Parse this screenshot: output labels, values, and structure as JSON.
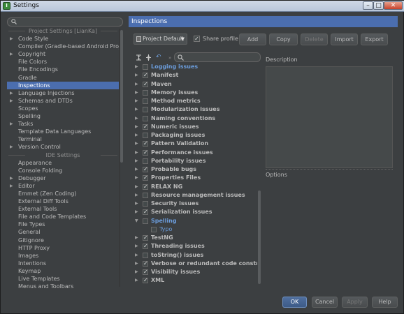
{
  "window": {
    "title": "Settings",
    "app_icon": "intellij-icon",
    "controls": [
      "minimize",
      "maximize",
      "close"
    ]
  },
  "sidebar": {
    "search_placeholder": "",
    "project_settings_header": "Project Settings [LianKa]",
    "ide_settings_header": "IDE Settings",
    "items": [
      {
        "label": "Code Style",
        "expandable": true
      },
      {
        "label": "Compiler (Gradle-based Android Proje...",
        "expandable": false
      },
      {
        "label": "Copyright",
        "expandable": true
      },
      {
        "label": "File Colors",
        "expandable": false
      },
      {
        "label": "File Encodings",
        "expandable": false
      },
      {
        "label": "Gradle",
        "expandable": false
      },
      {
        "label": "Inspections",
        "expandable": false,
        "selected": true
      },
      {
        "label": "Language Injections",
        "expandable": true
      },
      {
        "label": "Schemas and DTDs",
        "expandable": true
      },
      {
        "label": "Scopes",
        "expandable": false
      },
      {
        "label": "Spelling",
        "expandable": false
      },
      {
        "label": "Tasks",
        "expandable": true
      },
      {
        "label": "Template Data Languages",
        "expandable": false
      },
      {
        "label": "Terminal",
        "expandable": false
      },
      {
        "label": "Version Control",
        "expandable": true
      }
    ],
    "ide_items": [
      {
        "label": "Appearance",
        "expandable": false
      },
      {
        "label": "Console Folding",
        "expandable": false
      },
      {
        "label": "Debugger",
        "expandable": true
      },
      {
        "label": "Editor",
        "expandable": true
      },
      {
        "label": "Emmet (Zen Coding)",
        "expandable": false
      },
      {
        "label": "External Diff Tools",
        "expandable": false
      },
      {
        "label": "External Tools",
        "expandable": false
      },
      {
        "label": "File and Code Templates",
        "expandable": false
      },
      {
        "label": "File Types",
        "expandable": false
      },
      {
        "label": "General",
        "expandable": false
      },
      {
        "label": "Gitignore",
        "expandable": false
      },
      {
        "label": "HTTP Proxy",
        "expandable": false
      },
      {
        "label": "Images",
        "expandable": false
      },
      {
        "label": "Intentions",
        "expandable": false
      },
      {
        "label": "Keymap",
        "expandable": false
      },
      {
        "label": "Live Templates",
        "expandable": false
      },
      {
        "label": "Menus and Toolbars",
        "expandable": false
      }
    ]
  },
  "panel": {
    "header": "Inspections",
    "profile": "Project Default",
    "share_profile_label": "Share profile",
    "share_profile_checked": true,
    "buttons": {
      "add": "Add",
      "copy": "Copy",
      "delete": "Delete",
      "import": "Import",
      "export": "Export"
    },
    "toolbar_icons": [
      "expand-all-icon",
      "collapse-all-icon",
      "reset-icon",
      "search-icon"
    ],
    "inspections": [
      {
        "label": "Logging issues",
        "checked": false,
        "expanded": false,
        "highlight": true
      },
      {
        "label": "Manifest",
        "checked": true,
        "expanded": false
      },
      {
        "label": "Maven",
        "checked": true,
        "expanded": false
      },
      {
        "label": "Memory issues",
        "checked": false,
        "expanded": false
      },
      {
        "label": "Method metrics",
        "checked": false,
        "expanded": false
      },
      {
        "label": "Modularization issues",
        "checked": false,
        "expanded": false
      },
      {
        "label": "Naming conventions",
        "checked": false,
        "expanded": false
      },
      {
        "label": "Numeric issues",
        "checked": true,
        "expanded": false
      },
      {
        "label": "Packaging issues",
        "checked": false,
        "expanded": false
      },
      {
        "label": "Pattern Validation",
        "checked": true,
        "expanded": false
      },
      {
        "label": "Performance issues",
        "checked": true,
        "expanded": false
      },
      {
        "label": "Portability issues",
        "checked": false,
        "expanded": false
      },
      {
        "label": "Probable bugs",
        "checked": true,
        "expanded": false
      },
      {
        "label": "Properties Files",
        "checked": true,
        "expanded": false
      },
      {
        "label": "RELAX NG",
        "checked": true,
        "expanded": false
      },
      {
        "label": "Resource management issues",
        "checked": false,
        "expanded": false
      },
      {
        "label": "Security issues",
        "checked": false,
        "expanded": false
      },
      {
        "label": "Serialization issues",
        "checked": true,
        "expanded": false
      },
      {
        "label": "Spelling",
        "checked": false,
        "expanded": true,
        "highlight": true
      },
      {
        "label": "Typo",
        "checked": false,
        "child": true,
        "highlight": true
      },
      {
        "label": "TestNG",
        "checked": true,
        "expanded": false
      },
      {
        "label": "Threading issues",
        "checked": true,
        "expanded": false
      },
      {
        "label": "toString() issues",
        "checked": false,
        "expanded": false
      },
      {
        "label": "Verbose or redundant code constructs",
        "checked": true,
        "expanded": false
      },
      {
        "label": "Visibility issues",
        "checked": true,
        "expanded": false
      },
      {
        "label": "XML",
        "checked": true,
        "expanded": false
      }
    ],
    "description_label": "Description",
    "options_label": "Options"
  },
  "footer": {
    "ok": "OK",
    "cancel": "Cancel",
    "apply": "Apply",
    "help": "Help"
  },
  "colors": {
    "accent": "#4b6eaf",
    "background": "#3c3f41",
    "highlight_text": "#6b9cdb"
  }
}
